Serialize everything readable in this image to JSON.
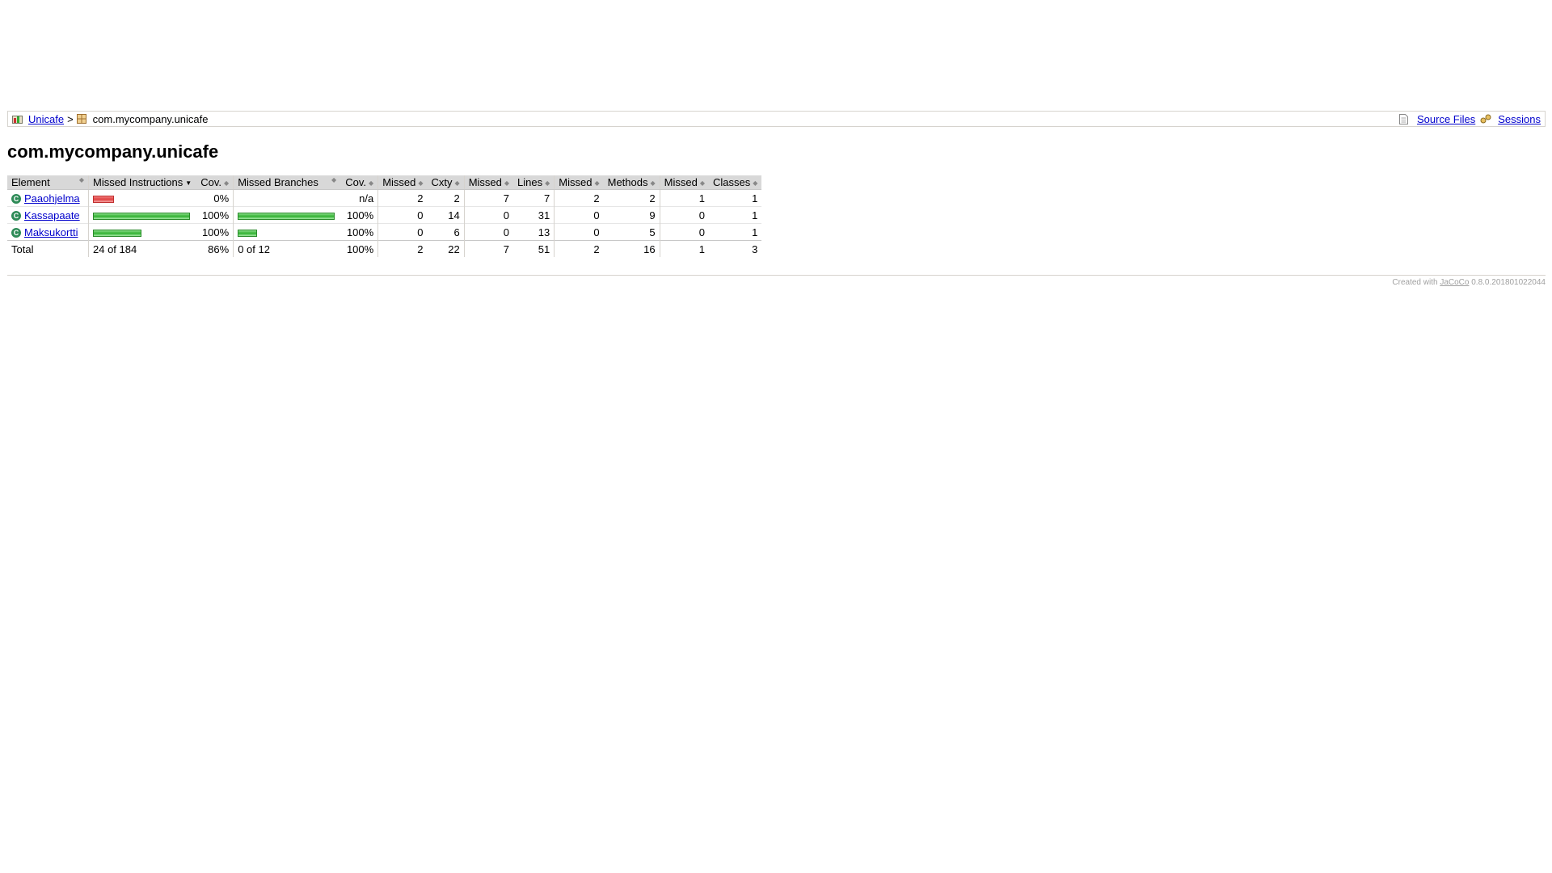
{
  "breadcrumb": {
    "root_label": "Unicafe",
    "separator": ">",
    "package_label": "com.mycompany.unicafe",
    "source_files_label": "Source Files",
    "sessions_label": "Sessions"
  },
  "page_title": "com.mycompany.unicafe",
  "table": {
    "headers": {
      "element": "Element",
      "missed_instructions": "Missed Instructions",
      "instr_cov": "Cov.",
      "missed_branches": "Missed Branches",
      "branch_cov": "Cov.",
      "cxty_missed": "Missed",
      "cxty": "Cxty",
      "lines_missed": "Missed",
      "lines": "Lines",
      "methods_missed": "Missed",
      "methods": "Methods",
      "classes_missed": "Missed",
      "classes": "Classes"
    },
    "rows": [
      {
        "name": "Paaohjelma",
        "instr_bar": {
          "missed_fraction": 0.22,
          "covered_fraction": 0.0
        },
        "instr_cov": "0%",
        "branch_bar": {
          "missed_fraction": 0.0,
          "covered_fraction": 0.0
        },
        "branch_cov": "n/a",
        "cxty_missed": "2",
        "cxty": "2",
        "lines_missed": "7",
        "lines": "7",
        "methods_missed": "2",
        "methods": "2",
        "classes_missed": "1",
        "classes": "1"
      },
      {
        "name": "Kassapaate",
        "instr_bar": {
          "missed_fraction": 0.0,
          "covered_fraction": 1.0
        },
        "instr_cov": "100%",
        "branch_bar": {
          "missed_fraction": 0.0,
          "covered_fraction": 1.0
        },
        "branch_cov": "100%",
        "cxty_missed": "0",
        "cxty": "14",
        "lines_missed": "0",
        "lines": "31",
        "methods_missed": "0",
        "methods": "9",
        "classes_missed": "0",
        "classes": "1"
      },
      {
        "name": "Maksukortti",
        "instr_bar": {
          "missed_fraction": 0.0,
          "covered_fraction": 0.5
        },
        "instr_cov": "100%",
        "branch_bar": {
          "missed_fraction": 0.0,
          "covered_fraction": 0.2
        },
        "branch_cov": "100%",
        "cxty_missed": "0",
        "cxty": "6",
        "lines_missed": "0",
        "lines": "13",
        "methods_missed": "0",
        "methods": "5",
        "classes_missed": "0",
        "classes": "1"
      }
    ],
    "total": {
      "label": "Total",
      "instr": "24 of 184",
      "instr_cov": "86%",
      "branch": "0 of 12",
      "branch_cov": "100%",
      "cxty_missed": "2",
      "cxty": "22",
      "lines_missed": "7",
      "lines": "51",
      "methods_missed": "2",
      "methods": "16",
      "classes_missed": "1",
      "classes": "3"
    }
  },
  "footer": {
    "prefix": "Created with",
    "link": "JaCoCo",
    "version": "0.8.0.201801022044"
  }
}
